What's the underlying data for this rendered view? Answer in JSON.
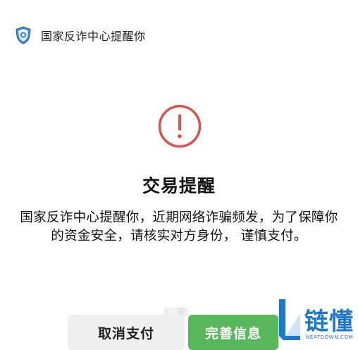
{
  "header": {
    "badge_icon": "police-badge-icon",
    "title": "国家反诈中心提醒你"
  },
  "alert": {
    "icon": "exclamation-circle-icon",
    "accent_color": "#d9534f",
    "heading": "交易提醒",
    "message": "国家反诈中心提醒你，近期网络诈骗频发，为了保障你的资金安全，请核实对方身份， 谨慎支付。"
  },
  "actions": {
    "cancel_label": "取消支付",
    "confirm_label": "完善信息",
    "confirm_color": "#57b85b"
  },
  "watermark": {
    "name": "链懂",
    "url": "NEATDOWN.COM",
    "color": "#1e77c8"
  }
}
